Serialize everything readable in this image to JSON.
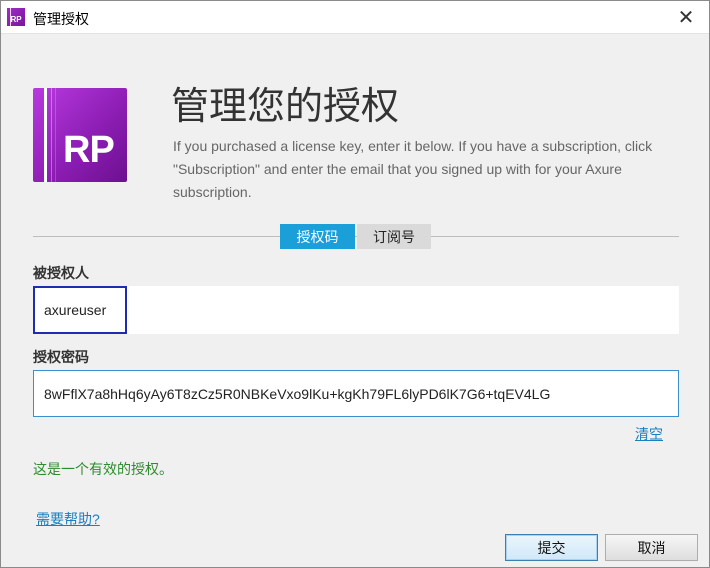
{
  "window": {
    "title": "管理授权",
    "icon_text": "RP",
    "close_glyph": "✕"
  },
  "logo": {
    "text": "RP"
  },
  "header": {
    "heading": "管理您的授权",
    "description": "If you purchased a license key, enter it below. If you have a subscription, click \"Subscription\" and enter the email that you signed up with for your Axure subscription."
  },
  "tabs": [
    {
      "label": "授权码",
      "active": true
    },
    {
      "label": "订阅号",
      "active": false
    }
  ],
  "form": {
    "licensee_label": "被授权人",
    "licensee_value": "axureuser",
    "key_label": "授权密码",
    "key_value": "8wFflX7a8hHq6yAy6T8zCz5R0NBKeVxo9lKu+kgKh79FL6lyPD6lK7G6+tqEV4LG",
    "clear_label": "清空"
  },
  "status": {
    "message": "这是一个有效的授权。",
    "color": "#2e8b2e"
  },
  "footer": {
    "help_label": "需要帮助?",
    "submit_label": "提交",
    "cancel_label": "取消"
  },
  "colors": {
    "accent": "#1a9fd8",
    "brand": "#9b27c6",
    "link": "#1a7fc0"
  }
}
